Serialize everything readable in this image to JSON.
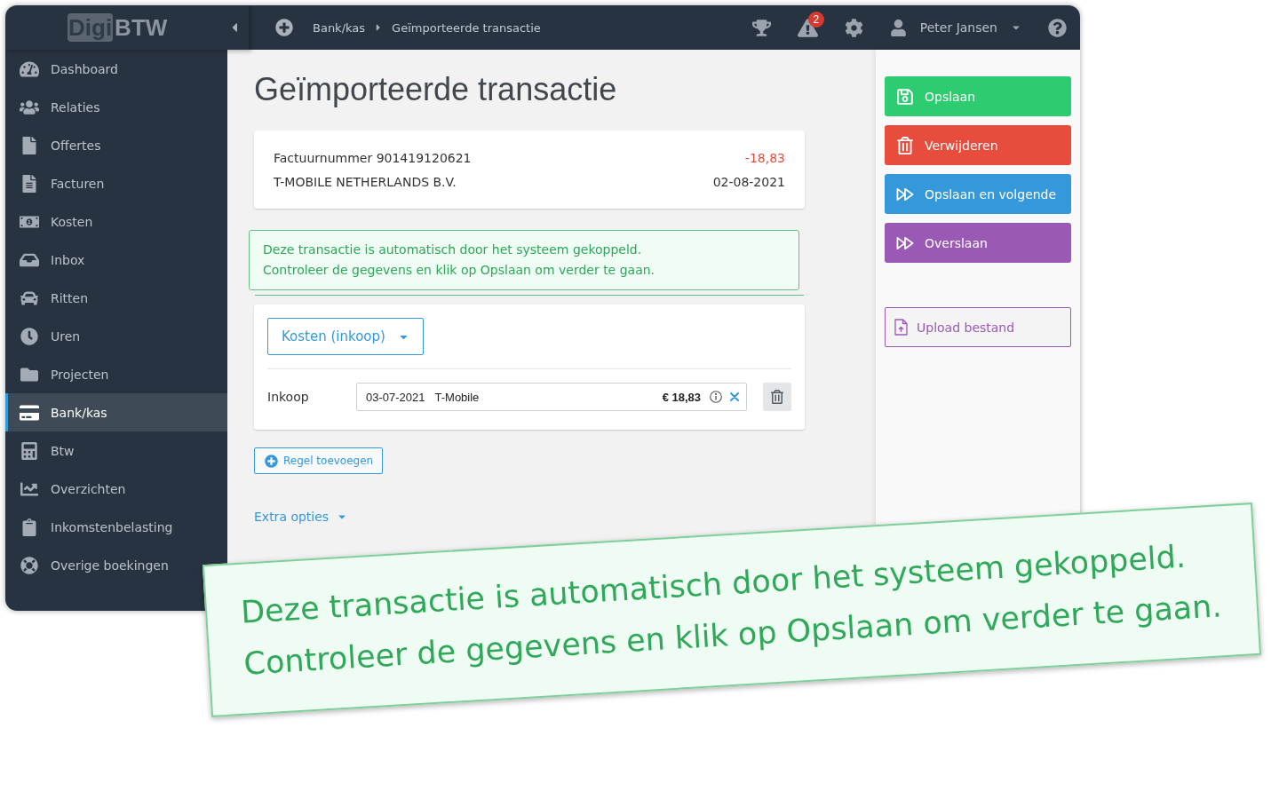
{
  "topbar": {
    "logo": {
      "boxed": "Digi",
      "plain": "BTW"
    },
    "breadcrumb": [
      "Bank/kas",
      "Geïmporteerde transactie"
    ],
    "alert_count": "2",
    "user_name": "Peter Jansen"
  },
  "sidebar": {
    "items": [
      {
        "label": "Dashboard",
        "selected": false
      },
      {
        "label": "Relaties",
        "selected": false
      },
      {
        "label": "Offertes",
        "selected": false
      },
      {
        "label": "Facturen",
        "selected": false
      },
      {
        "label": "Kosten",
        "selected": false
      },
      {
        "label": "Inbox",
        "selected": false
      },
      {
        "label": "Ritten",
        "selected": false
      },
      {
        "label": "Uren",
        "selected": false
      },
      {
        "label": "Projecten",
        "selected": false
      },
      {
        "label": "Bank/kas",
        "selected": true
      },
      {
        "label": "Btw",
        "selected": false
      },
      {
        "label": "Overzichten",
        "selected": false
      },
      {
        "label": "Inkomstenbelasting",
        "selected": false
      },
      {
        "label": "Overige boekingen",
        "selected": false
      }
    ]
  },
  "page_title": "Geïmporteerde transactie",
  "transaction": {
    "description": "Factuurnummer 901419120621",
    "amount": "-18,83",
    "counterparty": "T-MOBILE NETHERLANDS B.V.",
    "date": "02-08-2021"
  },
  "alert": {
    "lines": [
      "Deze transactie is automatisch door het systeem gekoppeld.",
      "Controleer de gegevens en klik op Opslaan om verder te gaan."
    ]
  },
  "booking": {
    "category": "Kosten (inkoop)",
    "lines": [
      {
        "label": "Inkoop",
        "date": "03-07-2021",
        "name": "T-Mobile",
        "amount": "€ 18,83"
      }
    ]
  },
  "add_line_button": "Regel toevoegen",
  "extra_options": "Extra opties",
  "actions": [
    {
      "label": "Opslaan",
      "color": "#2ecc71"
    },
    {
      "label": "Verwijderen",
      "color": "#e74c3c"
    },
    {
      "label": "Opslaan en volgende",
      "color": "#3498db"
    },
    {
      "label": "Overslaan",
      "color": "#9b59b6"
    }
  ],
  "upload_button": "Upload bestand",
  "callout": {
    "lines": [
      "Deze transactie is automatisch door het systeem gekoppeld.",
      "Controleer de gegevens en klik op Opslaan om verder te gaan."
    ]
  }
}
